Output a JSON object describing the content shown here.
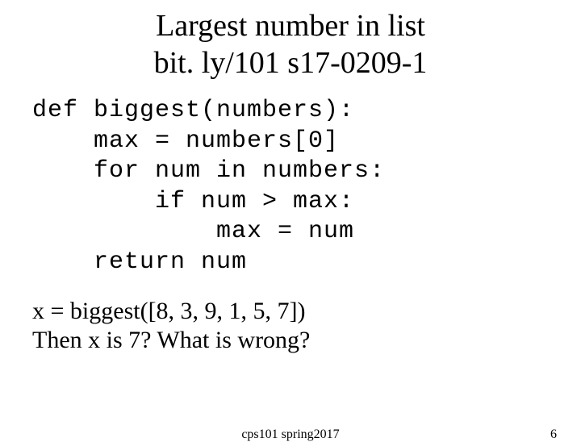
{
  "title_line1": "Largest number in list",
  "title_line2": "bit. ly/101 s17-0209-1",
  "code": "def biggest(numbers):\n    max = numbers[0]\n    for num in numbers:\n        if num > max:\n            max = num\n    return num",
  "outro_line1": "x =  biggest([8, 3, 9, 1, 5, 7])",
  "outro_line2": "Then x is 7?    What is wrong?",
  "footer_center": "cps101 spring2017",
  "footer_right": "6"
}
